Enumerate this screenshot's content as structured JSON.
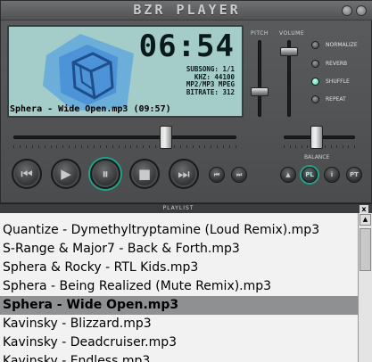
{
  "app": {
    "title": "BZR PLAYER"
  },
  "display": {
    "time": "06:54",
    "info": [
      "SUBSONG: 1/1",
      "KHZ: 44100",
      "MP2/MP3 MPEG",
      "BITRATE: 312"
    ],
    "current_track": "Sphera - Wide Open.mp3 (09:57)"
  },
  "sliders": {
    "pitch_label": "PITCH",
    "volume_label": "VOLUME",
    "balance_label": "BALANCE"
  },
  "options": [
    {
      "label": "NORMALIZE",
      "on": false
    },
    {
      "label": "REVERB",
      "on": false
    },
    {
      "label": "SHUFFLE",
      "on": true
    },
    {
      "label": "REPEAT",
      "on": false
    }
  ],
  "transport": {
    "prev_icon": "skip-back-icon",
    "play_icon": "play-icon",
    "pause_icon": "pause-icon",
    "stop_icon": "stop-icon",
    "next_icon": "skip-forward-icon"
  },
  "small_buttons": {
    "eject": "▲",
    "pl": "PL",
    "info": "i",
    "pt": "PT"
  },
  "playlist": {
    "title": "PLAYLIST",
    "close": "x",
    "items": [
      {
        "label": "Quantize - Dymethyltryptamine (Loud Remix).mp3",
        "current": false
      },
      {
        "label": "S-Range & Major7 - Back & Forth.mp3",
        "current": false
      },
      {
        "label": "Sphera & Rocky - RTL Kids.mp3",
        "current": false
      },
      {
        "label": "Sphera - Being Realized (Mute Remix).mp3",
        "current": false
      },
      {
        "label": "Sphera - Wide Open.mp3",
        "current": true
      },
      {
        "label": "Kavinsky - Blizzard.mp3",
        "current": false
      },
      {
        "label": "Kavinsky - Deadcruiser.mp3",
        "current": false
      },
      {
        "label": "Kavinsky - Endless.mp3",
        "current": false
      }
    ]
  },
  "colors": {
    "lcd": "#a4ccc8",
    "accent": "#1fa58c",
    "cube": "#3c8fd8"
  }
}
